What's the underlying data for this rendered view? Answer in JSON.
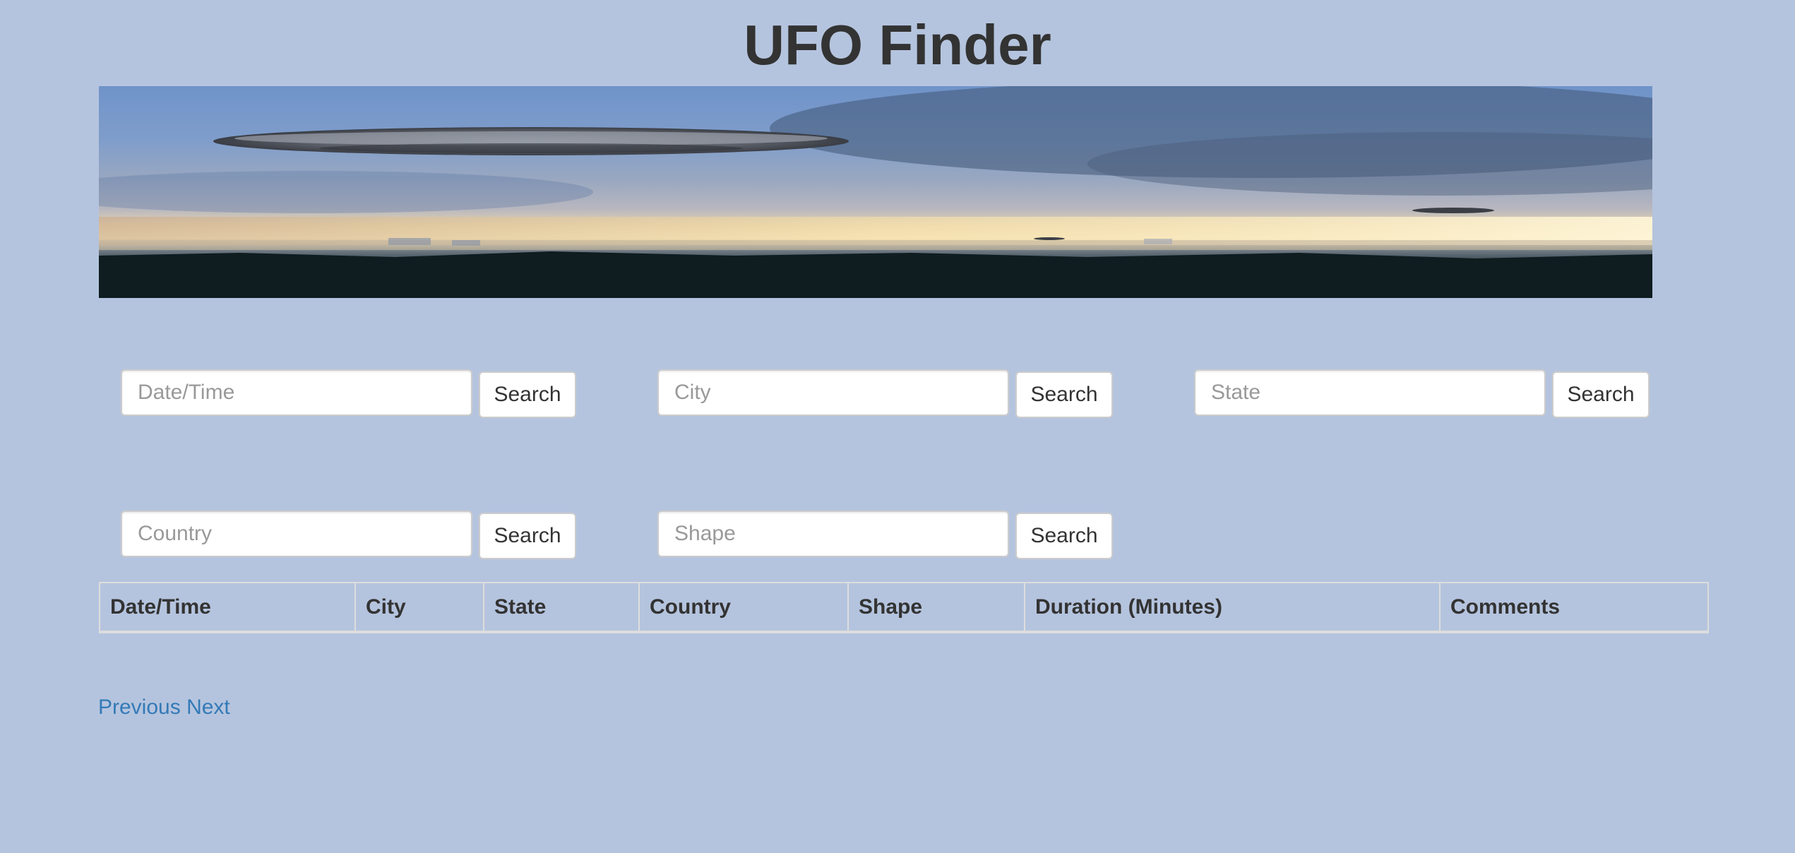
{
  "header": {
    "title": "UFO Finder"
  },
  "banner": {
    "image_alt": "flying saucers over city skyline at dusk"
  },
  "filters": {
    "datetime": {
      "placeholder": "Date/Time",
      "value": "",
      "button_label": "Search"
    },
    "city": {
      "placeholder": "City",
      "value": "",
      "button_label": "Search"
    },
    "state": {
      "placeholder": "State",
      "value": "",
      "button_label": "Search"
    },
    "country": {
      "placeholder": "Country",
      "value": "",
      "button_label": "Search"
    },
    "shape": {
      "placeholder": "Shape",
      "value": "",
      "button_label": "Search"
    }
  },
  "table": {
    "columns": [
      "Date/Time",
      "City",
      "State",
      "Country",
      "Shape",
      "Duration (Minutes)",
      "Comments"
    ],
    "rows": []
  },
  "pager": {
    "previous_label": "Previous",
    "next_label": "Next"
  },
  "colors": {
    "background": "#b5c4de",
    "title": "#333333",
    "link": "#337ab7"
  }
}
